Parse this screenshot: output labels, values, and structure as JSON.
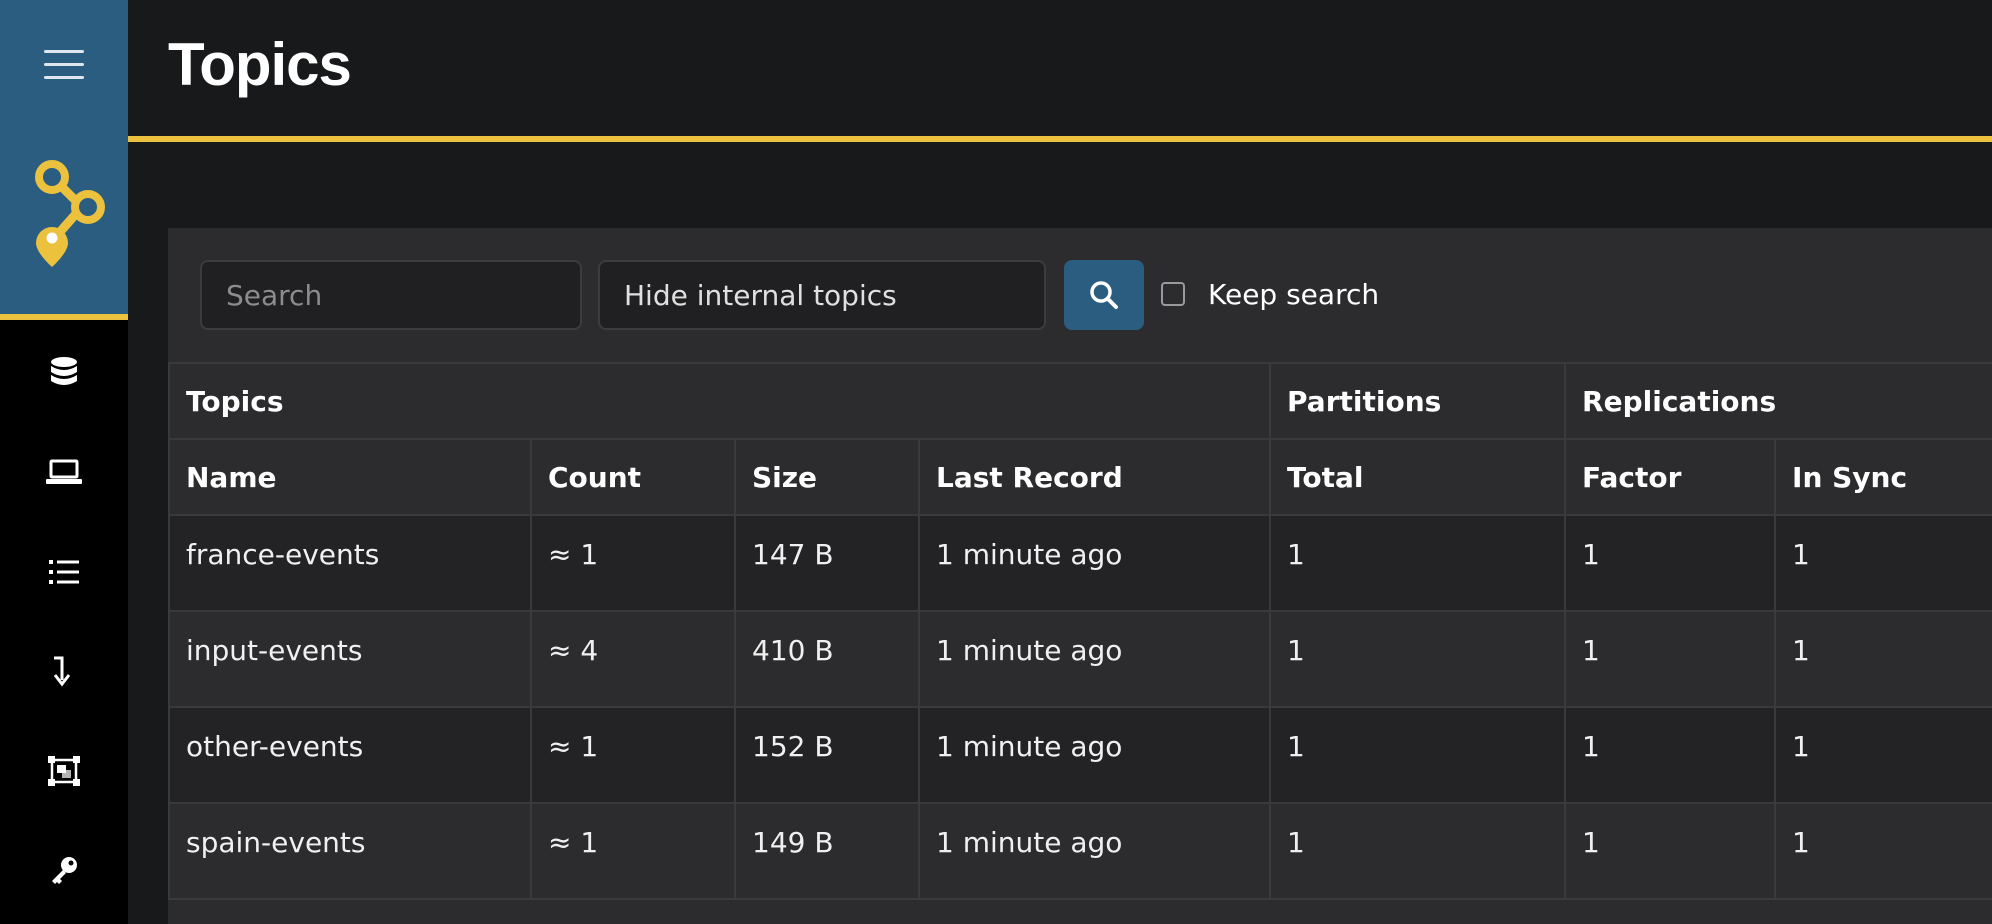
{
  "page": {
    "title": "Topics"
  },
  "sidebar": {
    "items": [
      {
        "name": "nodes",
        "icon": "database-icon"
      },
      {
        "name": "laptop",
        "icon": "laptop-icon"
      },
      {
        "name": "topics",
        "icon": "list-icon"
      },
      {
        "name": "arrow",
        "icon": "arrow-down-icon"
      },
      {
        "name": "schema",
        "icon": "schema-icon"
      },
      {
        "name": "acls",
        "icon": "key-icon"
      }
    ]
  },
  "toolbar": {
    "search_placeholder": "Search",
    "filter_value": "Hide internal topics",
    "keep_search_label": "Keep search"
  },
  "table": {
    "group_headers": [
      "Topics",
      "Partitions",
      "Replications"
    ],
    "columns": [
      "Name",
      "Count",
      "Size",
      "Last Record",
      "Total",
      "Factor",
      "In Sync"
    ],
    "rows": [
      [
        "france-events",
        "≈ 1",
        "147 B",
        "1 minute ago",
        "1",
        "1",
        "1"
      ],
      [
        "input-events",
        "≈ 4",
        "410 B",
        "1 minute ago",
        "1",
        "1",
        "1"
      ],
      [
        "other-events",
        "≈ 1",
        "152 B",
        "1 minute ago",
        "1",
        "1",
        "1"
      ],
      [
        "spain-events",
        "≈ 1",
        "149 B",
        "1 minute ago",
        "1",
        "1",
        "1"
      ]
    ]
  },
  "colors": {
    "accent": "#ebc13e",
    "primary": "#2a5d80",
    "background": "#18191b",
    "panel": "#2c2c2e"
  }
}
